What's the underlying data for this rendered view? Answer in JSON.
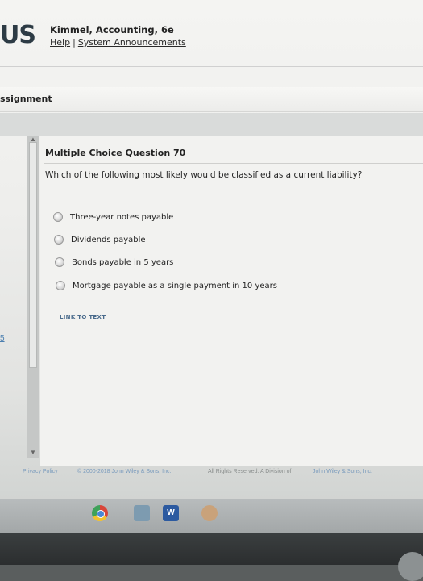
{
  "header": {
    "brand": "US",
    "book_title": "Kimmel, Accounting, 6e",
    "links": [
      "Help",
      "System Announcements"
    ],
    "separator": "|"
  },
  "assignment": {
    "title": "ssignment"
  },
  "sidebar": {
    "page_number": "5"
  },
  "question": {
    "heading": "Multiple Choice Question 70",
    "text": "Which of the following most likely would be classified as a current liability?",
    "options": [
      "Three-year notes payable",
      "Dividends payable",
      "Bonds payable in 5 years",
      "Mortgage payable as a single payment in 10 years"
    ],
    "link_label": "LINK TO TEXT"
  },
  "footer": {
    "privacy_link": "Privacy Policy",
    "copyright_link": "© 2000-2018 John Wiley & Sons, Inc.",
    "rights_text": "All Rights Reserved. A Division of",
    "company_link": "John Wiley & Sons, Inc."
  },
  "taskbar": {
    "icons": [
      "chrome-icon",
      "app-icon",
      "word-icon",
      "music-icon"
    ]
  }
}
